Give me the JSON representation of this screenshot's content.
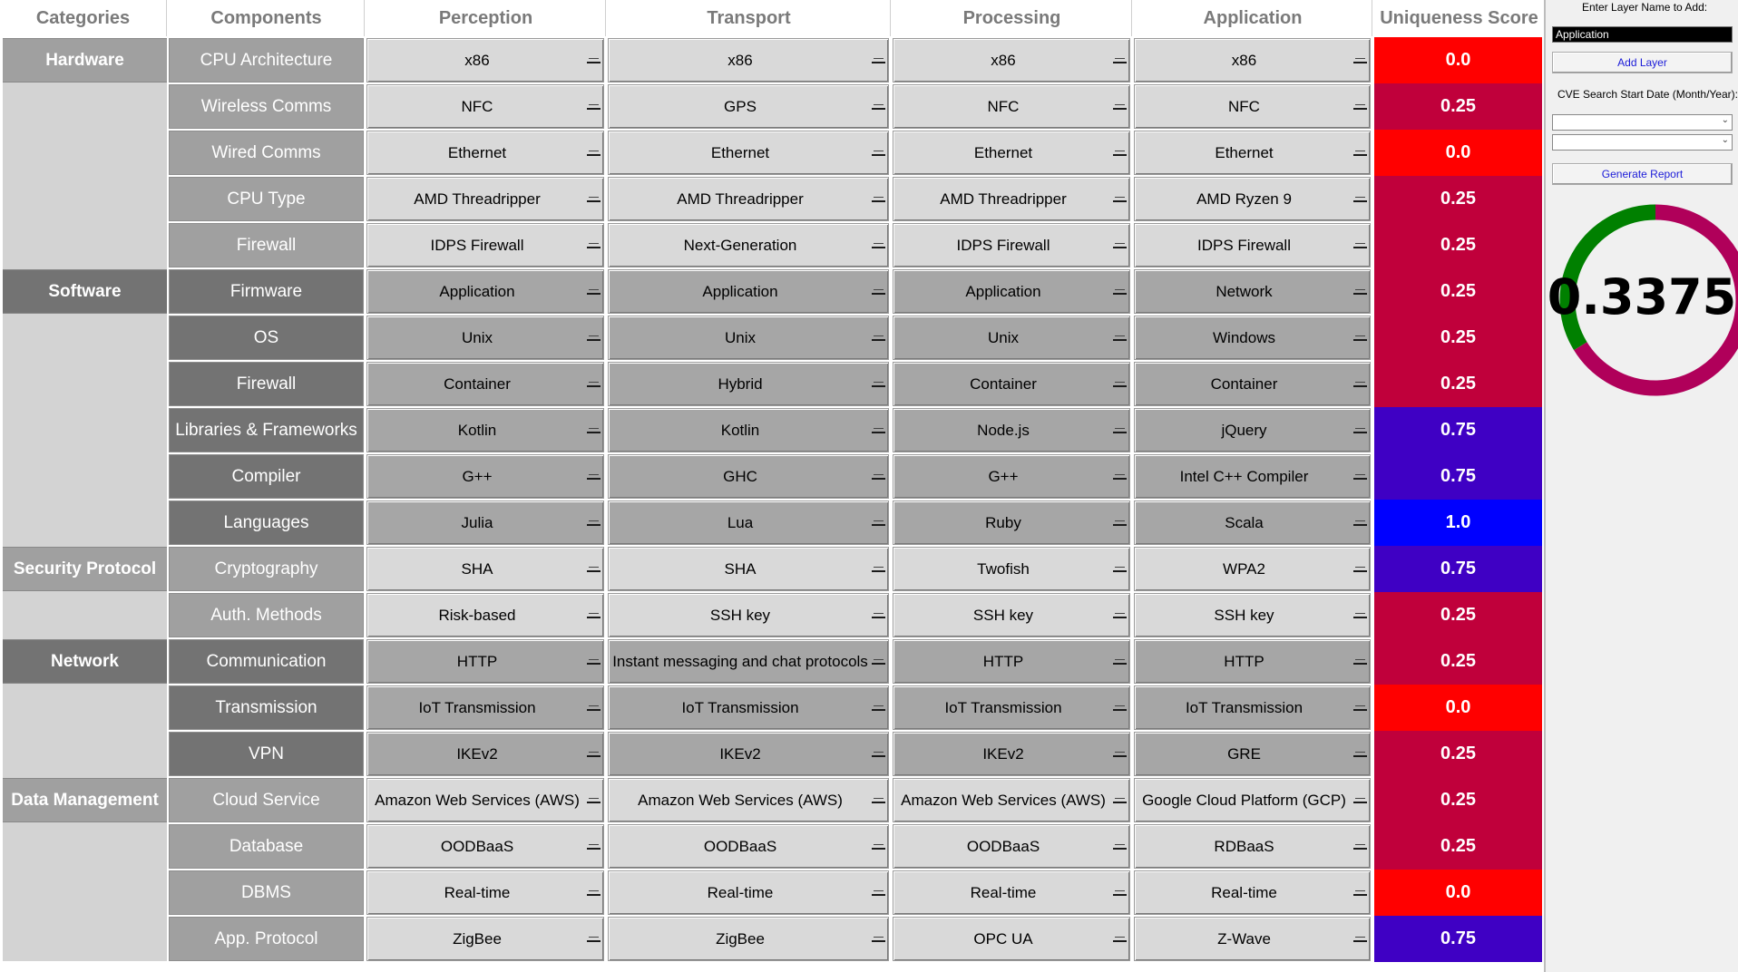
{
  "headers": [
    "Categories",
    "Components",
    "Perception",
    "Transport",
    "Processing",
    "Application",
    "Uniqueness Score"
  ],
  "categories": [
    {
      "label": "Hardware",
      "bg": "#a0a0a0"
    },
    {
      "label": "Software",
      "bg": "#737373"
    },
    {
      "label": "Security Protocol",
      "bg": "#a0a0a0"
    },
    {
      "label": "Network",
      "bg": "#737373"
    },
    {
      "label": "Data Management",
      "bg": "#a0a0a0"
    }
  ],
  "rows": [
    {
      "component": "CPU Architecture",
      "values": [
        "x86",
        "x86",
        "x86",
        "x86"
      ],
      "score": "0.0",
      "score_color": "#ff0000"
    },
    {
      "component": "Wireless Comms",
      "values": [
        "NFC",
        "GPS",
        "NFC",
        "NFC"
      ],
      "score": "0.25",
      "score_color": "#c0003b"
    },
    {
      "component": "Wired Comms",
      "values": [
        "Ethernet",
        "Ethernet",
        "Ethernet",
        "Ethernet"
      ],
      "score": "0.0",
      "score_color": "#ff0000"
    },
    {
      "component": "CPU Type",
      "values": [
        "AMD Threadripper",
        "AMD Threadripper",
        "AMD Threadripper",
        "AMD Ryzen 9"
      ],
      "score": "0.25",
      "score_color": "#c0003b"
    },
    {
      "component": "Firewall",
      "values": [
        "IDPS Firewall",
        "Next-Generation",
        "IDPS Firewall",
        "IDPS Firewall"
      ],
      "score": "0.25",
      "score_color": "#c0003b"
    },
    {
      "component": "Firmware",
      "values": [
        "Application",
        "Application",
        "Application",
        "Network"
      ],
      "score": "0.25",
      "score_color": "#c0003b"
    },
    {
      "component": "OS",
      "values": [
        "Unix",
        "Unix",
        "Unix",
        "Windows"
      ],
      "score": "0.25",
      "score_color": "#c0003b"
    },
    {
      "component": "Firewall",
      "values": [
        "Container",
        "Hybrid",
        "Container",
        "Container"
      ],
      "score": "0.25",
      "score_color": "#c0003b"
    },
    {
      "component": "Libraries & Frameworks",
      "values": [
        "Kotlin",
        "Kotlin",
        "Node.js",
        "jQuery"
      ],
      "score": "0.75",
      "score_color": "#3f00c4"
    },
    {
      "component": "Compiler",
      "values": [
        "G++",
        "GHC",
        "G++",
        "Intel C++ Compiler"
      ],
      "score": "0.75",
      "score_color": "#3f00c4"
    },
    {
      "component": "Languages",
      "values": [
        "Julia",
        "Lua",
        "Ruby",
        "Scala"
      ],
      "score": "1.0",
      "score_color": "#0000ff"
    },
    {
      "component": "Cryptography",
      "values": [
        "SHA",
        "SHA",
        "Twofish",
        "WPA2"
      ],
      "score": "0.75",
      "score_color": "#3f00c4"
    },
    {
      "component": "Auth. Methods",
      "values": [
        "Risk-based",
        "SSH key",
        "SSH key",
        "SSH key"
      ],
      "score": "0.25",
      "score_color": "#c0003b"
    },
    {
      "component": "Communication",
      "values": [
        "HTTP",
        "Instant messaging and chat protocols",
        "HTTP",
        "HTTP"
      ],
      "score": "0.25",
      "score_color": "#c0003b"
    },
    {
      "component": "Transmission",
      "values": [
        "IoT Transmission",
        "IoT Transmission",
        "IoT Transmission",
        "IoT Transmission"
      ],
      "score": "0.0",
      "score_color": "#ff0000"
    },
    {
      "component": "VPN",
      "values": [
        "IKEv2",
        "IKEv2",
        "IKEv2",
        "GRE"
      ],
      "score": "0.25",
      "score_color": "#c0003b"
    },
    {
      "component": "Cloud Service",
      "values": [
        "Amazon Web Services (AWS)",
        "Amazon Web Services (AWS)",
        "Amazon Web Services (AWS)",
        "Google Cloud Platform (GCP)"
      ],
      "score": "0.25",
      "score_color": "#c0003b"
    },
    {
      "component": "Database",
      "values": [
        "OODBaaS",
        "OODBaaS",
        "OODBaaS",
        "RDBaaS"
      ],
      "score": "0.25",
      "score_color": "#c0003b"
    },
    {
      "component": "DBMS",
      "values": [
        "Real-time",
        "Real-time",
        "Real-time",
        "Real-time"
      ],
      "score": "0.0",
      "score_color": "#ff0000"
    },
    {
      "component": "App. Protocol",
      "values": [
        "ZigBee",
        "ZigBee",
        "OPC UA",
        "Z-Wave"
      ],
      "score": "0.75",
      "score_color": "#3f00c4"
    }
  ],
  "panel": {
    "layer_label": "Enter Layer Name to Add:",
    "layer_value": "Application",
    "add_layer_button": "Add Layer",
    "cve_label": "CVE Search Start Date (Month/Year):",
    "month_value": "",
    "year_value": "",
    "generate_button": "Generate Report",
    "overall_score": "0.3375",
    "overall_score_fraction": 0.3375,
    "gauge_fill_color": "#008000",
    "gauge_rest_color": "#b0005a"
  }
}
